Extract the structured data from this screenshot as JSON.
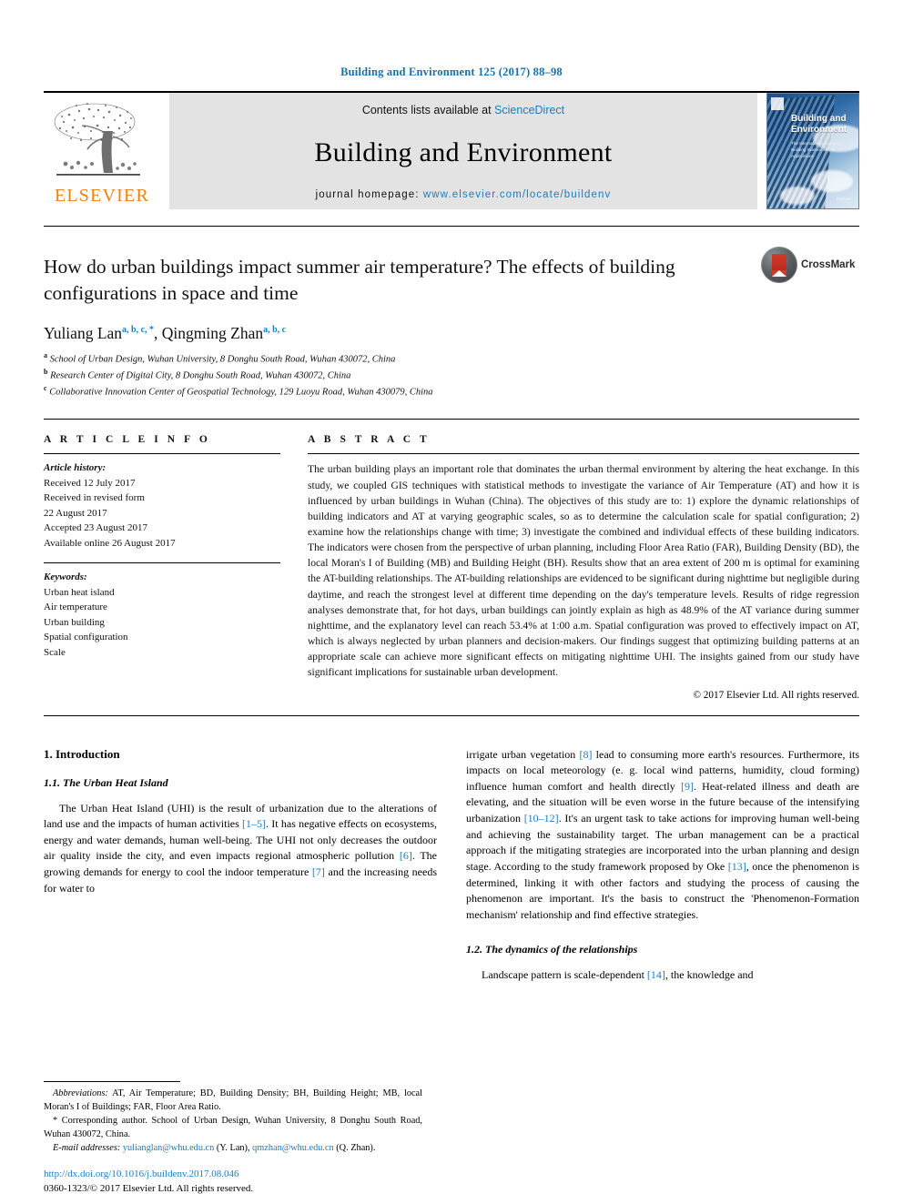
{
  "running_head": "Building and Environment 125 (2017) 88–98",
  "masthead": {
    "publisher": "ELSEVIER",
    "contents_prefix": "Contents lists available at ",
    "contents_link": "ScienceDirect",
    "journal_title": "Building and Environment",
    "homepage_prefix": "journal homepage: ",
    "homepage_url": "www.elsevier.com/locate/buildenv",
    "cover": {
      "title": "Building and Environment",
      "subtitle": "The International Journal of Building Science and its Applications",
      "editors": "Editor-in-Chief: Qingyan Chen",
      "footer": "Elsevier"
    }
  },
  "article": {
    "title": "How do urban buildings impact summer air temperature? The effects of building configurations in space and time",
    "crossmark_label": "CrossMark",
    "authors": [
      {
        "name": "Yuliang Lan",
        "marks": "a, b, c, *"
      },
      {
        "name": "Qingming Zhan",
        "marks": "a, b, c"
      }
    ],
    "affiliations": [
      {
        "mark": "a",
        "text": "School of Urban Design, Wuhan University, 8 Donghu South Road, Wuhan 430072, China"
      },
      {
        "mark": "b",
        "text": "Research Center of Digital City, 8 Donghu South Road, Wuhan 430072, China"
      },
      {
        "mark": "c",
        "text": "Collaborative Innovation Center of Geospatial Technology, 129 Luoyu Road, Wuhan 430079, China"
      }
    ]
  },
  "article_info": {
    "heading": "A R T I C L E  I N F O",
    "history_label": "Article history:",
    "history": [
      "Received 12 July 2017",
      "Received in revised form",
      "22 August 2017",
      "Accepted 23 August 2017",
      "Available online 26 August 2017"
    ],
    "keywords_label": "Keywords:",
    "keywords": [
      "Urban heat island",
      "Air temperature",
      "Urban building",
      "Spatial configuration",
      "Scale"
    ]
  },
  "abstract": {
    "heading": "A B S T R A C T",
    "text": "The urban building plays an important role that dominates the urban thermal environment by altering the heat exchange. In this study, we coupled GIS techniques with statistical methods to investigate the variance of Air Temperature (AT) and how it is influenced by urban buildings in Wuhan (China). The objectives of this study are to: 1) explore the dynamic relationships of building indicators and AT at varying geographic scales, so as to determine the calculation scale for spatial configuration; 2) examine how the relationships change with time; 3) investigate the combined and individual effects of these building indicators. The indicators were chosen from the perspective of urban planning, including Floor Area Ratio (FAR), Building Density (BD), the local Moran's I of Building (MB) and Building Height (BH). Results show that an area extent of 200 m is optimal for examining the AT-building relationships. The AT-building relationships are evidenced to be significant during nighttime but negligible during daytime, and reach the strongest level at different time depending on the day's temperature levels. Results of ridge regression analyses demonstrate that, for hot days, urban buildings can jointly explain as high as 48.9% of the AT variance during summer nighttime, and the explanatory level can reach 53.4% at 1:00 a.m. Spatial configuration was proved to effectively impact on AT, which is always neglected by urban planners and decision-makers. Our findings suggest that optimizing building patterns at an appropriate scale can achieve more significant effects on mitigating nighttime UHI. The insights gained from our study have significant implications for sustainable urban development.",
    "copyright": "© 2017 Elsevier Ltd. All rights reserved."
  },
  "body": {
    "section1_heading": "1. Introduction",
    "section11_heading": "1.1. The Urban Heat Island",
    "left_para_1a": "The Urban Heat Island (UHI) is the result of urbanization due to the alterations of land use and the impacts of human activities ",
    "left_cite_1": "[1–5]",
    "left_para_1b": ". It has negative effects on ecosystems, energy and water demands, human well-being. The UHI not only decreases the outdoor air quality inside the city, and even impacts regional atmospheric pollution ",
    "left_cite_2": "[6]",
    "left_para_1c": ". The growing demands for energy to cool the indoor temperature ",
    "left_cite_3": "[7]",
    "left_para_1d": " and the increasing needs for water to",
    "right_para_1a": "irrigate urban vegetation ",
    "right_cite_1": "[8]",
    "right_para_1b": " lead to consuming more earth's resources. Furthermore, its impacts on local meteorology (e. g. local wind patterns, humidity, cloud forming) influence human comfort and health directly ",
    "right_cite_2": "[9]",
    "right_para_1c": ". Heat-related illness and death are elevating, and the situation will be even worse in the future because of the intensifying urbanization ",
    "right_cite_3": "[10–12]",
    "right_para_1d": ". It's an urgent task to take actions for improving human well-being and achieving the sustainability target. The urban management can be a practical approach if the mitigating strategies are incorporated into the urban planning and design stage. According to the study framework proposed by Oke ",
    "right_cite_4": "[13]",
    "right_para_1e": ", once the phenomenon is determined, linking it with other factors and studying the process of causing the phenomenon are important. It's the basis to construct the 'Phenomenon-Formation mechanism' relationship and find effective strategies.",
    "section12_heading": "1.2. The dynamics of the relationships",
    "right_para_2a": "Landscape pattern is scale-dependent ",
    "right_cite_5": "[14]",
    "right_para_2b": ", the knowledge and"
  },
  "footnotes": {
    "abbrev_label": "Abbreviations:",
    "abbrev_text": " AT, Air Temperature; BD, Building Density; BH, Building Height; MB, local Moran's I of Buildings; FAR, Floor Area Ratio.",
    "corresponding": "* Corresponding author. School of Urban Design, Wuhan University, 8 Donghu South Road, Wuhan 430072, China.",
    "email_label": "E-mail addresses:",
    "email_1": "yulianglan@whu.edu.cn",
    "email_1_owner": " (Y. Lan), ",
    "email_2": "qmzhan@whu.edu.cn",
    "email_2_owner": " (Q. Zhan)."
  },
  "doi_block": {
    "doi": "http://dx.doi.org/10.1016/j.buildenv.2017.08.046",
    "issn_line": "0360-1323/© 2017 Elsevier Ltd. All rights reserved."
  },
  "colors": {
    "link_blue": "#1b7cbe",
    "elsevier_orange": "#ec8013",
    "band_grey": "#e3e3e3"
  }
}
